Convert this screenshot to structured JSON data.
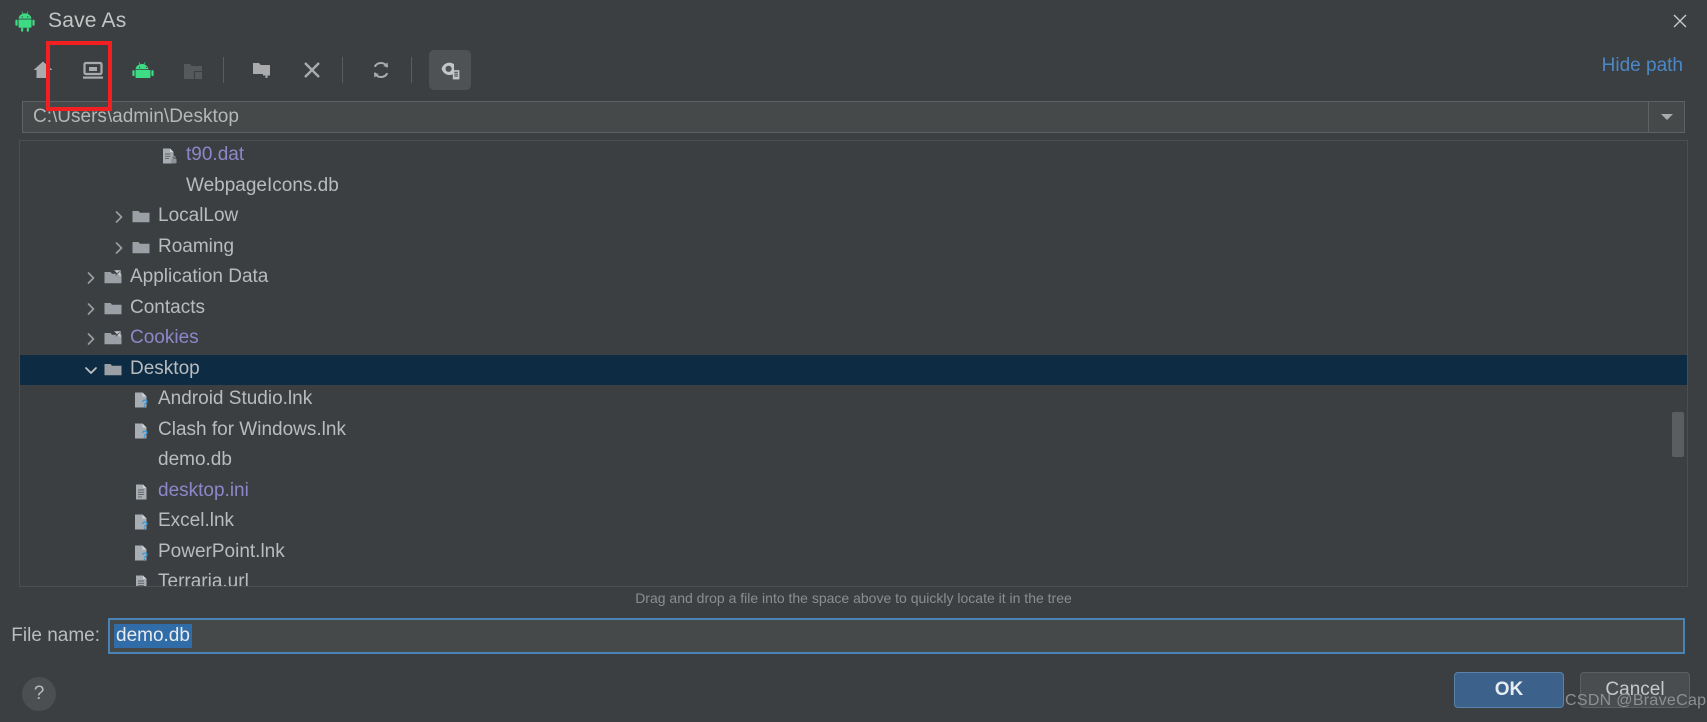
{
  "window": {
    "title": "Save As",
    "app_icon": "android-icon",
    "close_icon": "close-icon",
    "accent_blue": "#4a88c7",
    "selection_blue": "#0d2c44",
    "android_green": "#3ddc84",
    "annotation_color": "#f41f20"
  },
  "toolbar": {
    "buttons": [
      {
        "name": "home-icon",
        "title": "Home"
      },
      {
        "name": "desktop-icon",
        "title": "Desktop"
      },
      {
        "name": "android-project-icon",
        "title": "Project"
      },
      {
        "name": "module-folder-icon",
        "title": "Module"
      },
      {
        "name": "new-folder-icon",
        "title": "New Folder"
      },
      {
        "name": "delete-icon",
        "title": "Delete"
      },
      {
        "name": "refresh-icon",
        "title": "Refresh"
      },
      {
        "name": "show-hidden-files-icon",
        "title": "Show Hidden Files and Directories"
      }
    ],
    "hide_path_label": "Hide path"
  },
  "path": {
    "value": "C:\\Users\\admin\\Desktop",
    "dropdown_icon": "chevron-down-icon"
  },
  "tree": {
    "items": [
      {
        "label": "t90.dat",
        "indent": 3,
        "twisty": "",
        "icon": "locked-file-icon",
        "hidden": true,
        "selected": false
      },
      {
        "label": "WebpageIcons.db",
        "indent": 3,
        "twisty": "",
        "icon": "none",
        "hidden": false,
        "selected": false
      },
      {
        "label": "LocalLow",
        "indent": 2,
        "twisty": ">",
        "icon": "folder-icon",
        "hidden": false,
        "selected": false
      },
      {
        "label": "Roaming",
        "indent": 2,
        "twisty": ">",
        "icon": "folder-icon",
        "hidden": false,
        "selected": false
      },
      {
        "label": "Application Data",
        "indent": 1,
        "twisty": ">",
        "icon": "folder-link-icon",
        "hidden": false,
        "selected": false
      },
      {
        "label": "Contacts",
        "indent": 1,
        "twisty": ">",
        "icon": "folder-icon",
        "hidden": false,
        "selected": false
      },
      {
        "label": "Cookies",
        "indent": 1,
        "twisty": ">",
        "icon": "folder-link-icon",
        "hidden": true,
        "selected": false
      },
      {
        "label": "Desktop",
        "indent": 1,
        "twisty": "v",
        "icon": "folder-icon",
        "hidden": false,
        "selected": true
      },
      {
        "label": "Android Studio.lnk",
        "indent": 2,
        "twisty": "",
        "icon": "unknown-file-icon",
        "hidden": false,
        "selected": false
      },
      {
        "label": "Clash for Windows.lnk",
        "indent": 2,
        "twisty": "",
        "icon": "unknown-file-icon",
        "hidden": false,
        "selected": false
      },
      {
        "label": "demo.db",
        "indent": 2,
        "twisty": "",
        "icon": "none",
        "hidden": false,
        "selected": false
      },
      {
        "label": "desktop.ini",
        "indent": 2,
        "twisty": "",
        "icon": "text-file-icon",
        "hidden": true,
        "selected": false
      },
      {
        "label": "Excel.lnk",
        "indent": 2,
        "twisty": "",
        "icon": "unknown-file-icon",
        "hidden": false,
        "selected": false
      },
      {
        "label": "PowerPoint.lnk",
        "indent": 2,
        "twisty": "",
        "icon": "unknown-file-icon",
        "hidden": false,
        "selected": false
      },
      {
        "label": "Terraria.url",
        "indent": 2,
        "twisty": "",
        "icon": "text-file-icon",
        "hidden": false,
        "selected": false
      }
    ]
  },
  "hint": {
    "text": "Drag and drop a file into the space above to quickly locate it in the tree"
  },
  "filename": {
    "label": "File name:",
    "value": "demo.db"
  },
  "footer": {
    "help_label": "?",
    "ok_label": "OK",
    "cancel_label": "Cancel",
    "watermark": "CSDN @BraveCap"
  }
}
